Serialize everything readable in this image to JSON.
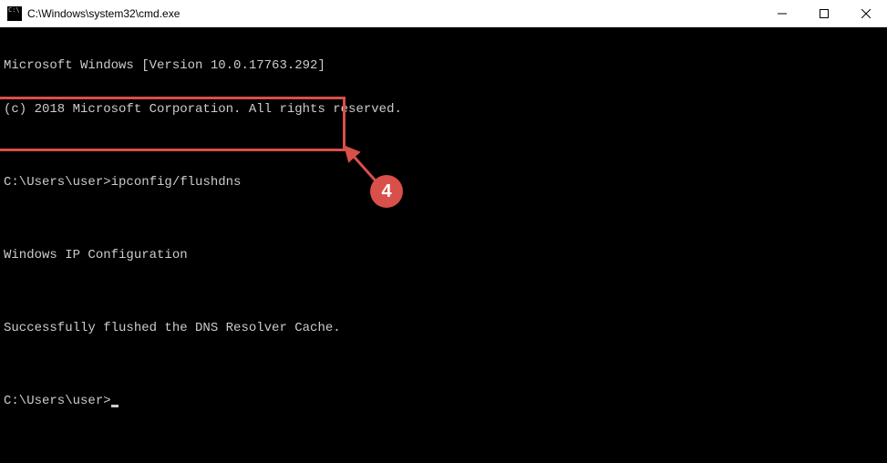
{
  "window": {
    "title": "C:\\Windows\\system32\\cmd.exe"
  },
  "terminal": {
    "line1": "Microsoft Windows [Version 10.0.17763.292]",
    "line2": "(c) 2018 Microsoft Corporation. All rights reserved.",
    "blank1": "",
    "promptLine1Prefix": "C:\\Users\\user>",
    "promptLine1Command": "ipconfig/flushdns",
    "blank2": "",
    "output1": "Windows IP Configuration",
    "blank3": "",
    "output2": "Successfully flushed the DNS Resolver Cache.",
    "blank4": "",
    "promptLine2Prefix": "C:\\Users\\user>"
  },
  "annotation": {
    "badge": "4"
  }
}
